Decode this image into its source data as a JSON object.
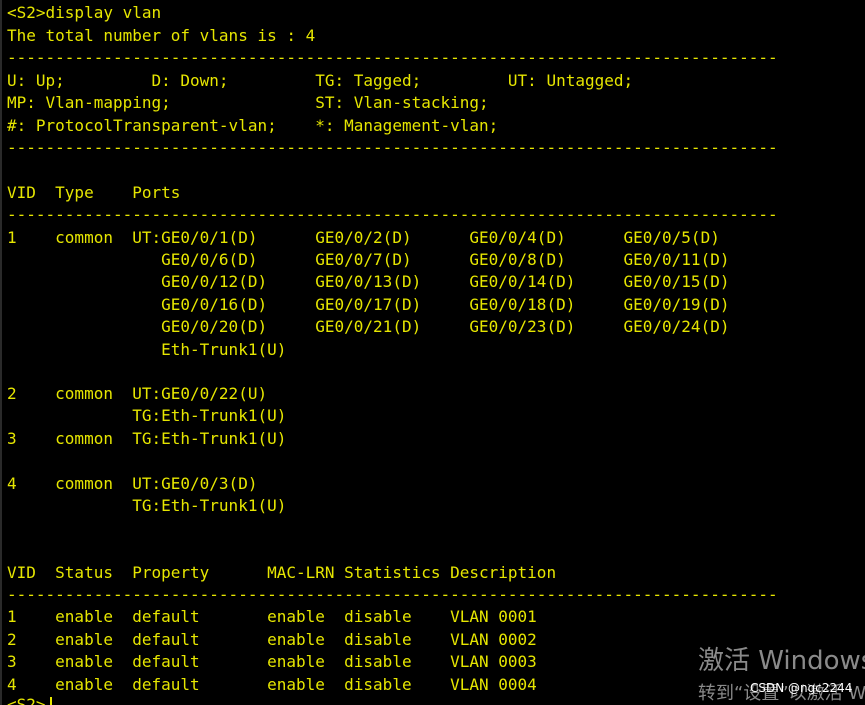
{
  "colors": {
    "background": "#000000",
    "text": "#e6e600",
    "watermark": "#8a8a8a",
    "csdn_text": "#ffffff"
  },
  "terminal": {
    "lines": [
      "<S2>display vlan",
      "The total number of vlans is : 4",
      "--------------------------------------------------------------------------------",
      "U: Up;         D: Down;         TG: Tagged;         UT: Untagged;",
      "MP: Vlan-mapping;               ST: Vlan-stacking;",
      "#: ProtocolTransparent-vlan;    *: Management-vlan;",
      "--------------------------------------------------------------------------------",
      "",
      "VID  Type    Ports",
      "--------------------------------------------------------------------------------",
      "1    common  UT:GE0/0/1(D)      GE0/0/2(D)      GE0/0/4(D)      GE0/0/5(D)",
      "                GE0/0/6(D)      GE0/0/7(D)      GE0/0/8(D)      GE0/0/11(D)",
      "                GE0/0/12(D)     GE0/0/13(D)     GE0/0/14(D)     GE0/0/15(D)",
      "                GE0/0/16(D)     GE0/0/17(D)     GE0/0/18(D)     GE0/0/19(D)",
      "                GE0/0/20(D)     GE0/0/21(D)     GE0/0/23(D)     GE0/0/24(D)",
      "                Eth-Trunk1(U)",
      "",
      "2    common  UT:GE0/0/22(U)",
      "             TG:Eth-Trunk1(U)",
      "3    common  TG:Eth-Trunk1(U)",
      "",
      "4    common  UT:GE0/0/3(D)",
      "             TG:Eth-Trunk1(U)",
      "",
      "",
      "VID  Status  Property      MAC-LRN Statistics Description",
      "--------------------------------------------------------------------------------",
      "1    enable  default       enable  disable    VLAN 0001",
      "2    enable  default       enable  disable    VLAN 0002",
      "3    enable  default       enable  disable    VLAN 0003",
      "4    enable  default       enable  disable    VLAN 0004",
      "<S2>"
    ]
  },
  "watermark": {
    "title": "激活 Windows",
    "subtitle": "转到“设置”以激活 Windows。"
  },
  "csdn": {
    "label": "CSDN @ngc2244"
  }
}
